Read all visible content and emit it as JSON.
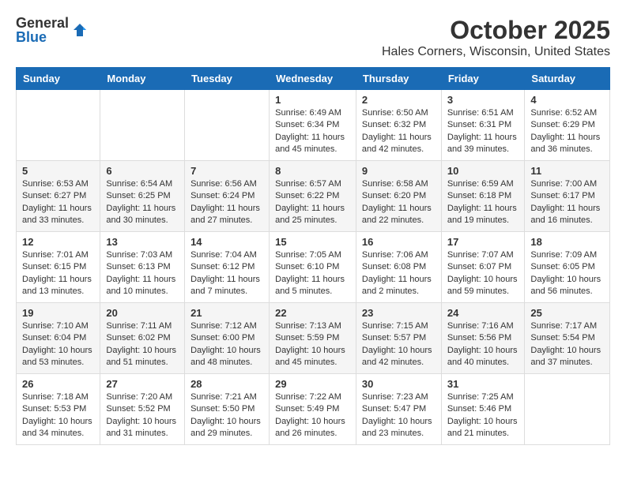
{
  "logo": {
    "general": "General",
    "blue": "Blue"
  },
  "title": "October 2025",
  "subtitle": "Hales Corners, Wisconsin, United States",
  "days_of_week": [
    "Sunday",
    "Monday",
    "Tuesday",
    "Wednesday",
    "Thursday",
    "Friday",
    "Saturday"
  ],
  "weeks": [
    [
      {
        "day": "",
        "info": ""
      },
      {
        "day": "",
        "info": ""
      },
      {
        "day": "",
        "info": ""
      },
      {
        "day": "1",
        "info": "Sunrise: 6:49 AM\nSunset: 6:34 PM\nDaylight: 11 hours\nand 45 minutes."
      },
      {
        "day": "2",
        "info": "Sunrise: 6:50 AM\nSunset: 6:32 PM\nDaylight: 11 hours\nand 42 minutes."
      },
      {
        "day": "3",
        "info": "Sunrise: 6:51 AM\nSunset: 6:31 PM\nDaylight: 11 hours\nand 39 minutes."
      },
      {
        "day": "4",
        "info": "Sunrise: 6:52 AM\nSunset: 6:29 PM\nDaylight: 11 hours\nand 36 minutes."
      }
    ],
    [
      {
        "day": "5",
        "info": "Sunrise: 6:53 AM\nSunset: 6:27 PM\nDaylight: 11 hours\nand 33 minutes."
      },
      {
        "day": "6",
        "info": "Sunrise: 6:54 AM\nSunset: 6:25 PM\nDaylight: 11 hours\nand 30 minutes."
      },
      {
        "day": "7",
        "info": "Sunrise: 6:56 AM\nSunset: 6:24 PM\nDaylight: 11 hours\nand 27 minutes."
      },
      {
        "day": "8",
        "info": "Sunrise: 6:57 AM\nSunset: 6:22 PM\nDaylight: 11 hours\nand 25 minutes."
      },
      {
        "day": "9",
        "info": "Sunrise: 6:58 AM\nSunset: 6:20 PM\nDaylight: 11 hours\nand 22 minutes."
      },
      {
        "day": "10",
        "info": "Sunrise: 6:59 AM\nSunset: 6:18 PM\nDaylight: 11 hours\nand 19 minutes."
      },
      {
        "day": "11",
        "info": "Sunrise: 7:00 AM\nSunset: 6:17 PM\nDaylight: 11 hours\nand 16 minutes."
      }
    ],
    [
      {
        "day": "12",
        "info": "Sunrise: 7:01 AM\nSunset: 6:15 PM\nDaylight: 11 hours\nand 13 minutes."
      },
      {
        "day": "13",
        "info": "Sunrise: 7:03 AM\nSunset: 6:13 PM\nDaylight: 11 hours\nand 10 minutes."
      },
      {
        "day": "14",
        "info": "Sunrise: 7:04 AM\nSunset: 6:12 PM\nDaylight: 11 hours\nand 7 minutes."
      },
      {
        "day": "15",
        "info": "Sunrise: 7:05 AM\nSunset: 6:10 PM\nDaylight: 11 hours\nand 5 minutes."
      },
      {
        "day": "16",
        "info": "Sunrise: 7:06 AM\nSunset: 6:08 PM\nDaylight: 11 hours\nand 2 minutes."
      },
      {
        "day": "17",
        "info": "Sunrise: 7:07 AM\nSunset: 6:07 PM\nDaylight: 10 hours\nand 59 minutes."
      },
      {
        "day": "18",
        "info": "Sunrise: 7:09 AM\nSunset: 6:05 PM\nDaylight: 10 hours\nand 56 minutes."
      }
    ],
    [
      {
        "day": "19",
        "info": "Sunrise: 7:10 AM\nSunset: 6:04 PM\nDaylight: 10 hours\nand 53 minutes."
      },
      {
        "day": "20",
        "info": "Sunrise: 7:11 AM\nSunset: 6:02 PM\nDaylight: 10 hours\nand 51 minutes."
      },
      {
        "day": "21",
        "info": "Sunrise: 7:12 AM\nSunset: 6:00 PM\nDaylight: 10 hours\nand 48 minutes."
      },
      {
        "day": "22",
        "info": "Sunrise: 7:13 AM\nSunset: 5:59 PM\nDaylight: 10 hours\nand 45 minutes."
      },
      {
        "day": "23",
        "info": "Sunrise: 7:15 AM\nSunset: 5:57 PM\nDaylight: 10 hours\nand 42 minutes."
      },
      {
        "day": "24",
        "info": "Sunrise: 7:16 AM\nSunset: 5:56 PM\nDaylight: 10 hours\nand 40 minutes."
      },
      {
        "day": "25",
        "info": "Sunrise: 7:17 AM\nSunset: 5:54 PM\nDaylight: 10 hours\nand 37 minutes."
      }
    ],
    [
      {
        "day": "26",
        "info": "Sunrise: 7:18 AM\nSunset: 5:53 PM\nDaylight: 10 hours\nand 34 minutes."
      },
      {
        "day": "27",
        "info": "Sunrise: 7:20 AM\nSunset: 5:52 PM\nDaylight: 10 hours\nand 31 minutes."
      },
      {
        "day": "28",
        "info": "Sunrise: 7:21 AM\nSunset: 5:50 PM\nDaylight: 10 hours\nand 29 minutes."
      },
      {
        "day": "29",
        "info": "Sunrise: 7:22 AM\nSunset: 5:49 PM\nDaylight: 10 hours\nand 26 minutes."
      },
      {
        "day": "30",
        "info": "Sunrise: 7:23 AM\nSunset: 5:47 PM\nDaylight: 10 hours\nand 23 minutes."
      },
      {
        "day": "31",
        "info": "Sunrise: 7:25 AM\nSunset: 5:46 PM\nDaylight: 10 hours\nand 21 minutes."
      },
      {
        "day": "",
        "info": ""
      }
    ]
  ]
}
